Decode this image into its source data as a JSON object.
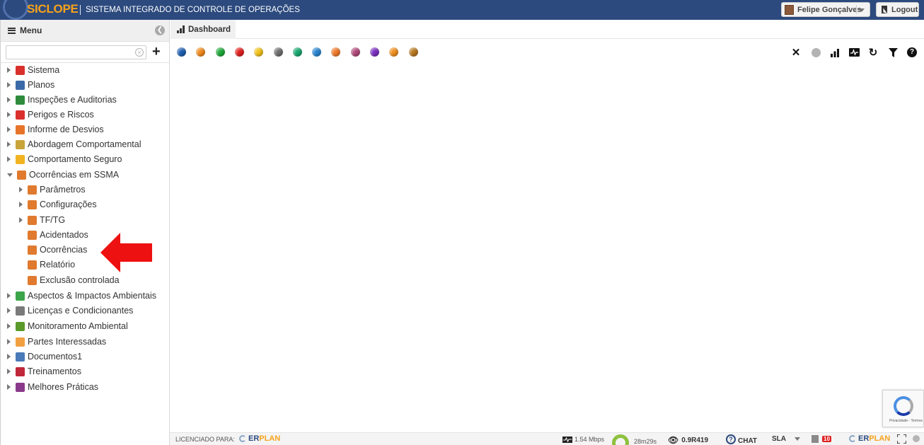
{
  "header": {
    "logo_text": "SICLOPE",
    "system_title": "SISTEMA INTEGRADO DE CONTROLE DE OPERAÇÕES",
    "user_name": "Felipe Gonçalves",
    "logout_label": "Logout"
  },
  "sidebar": {
    "title": "Menu",
    "search": {
      "value": "",
      "placeholder": ""
    },
    "items": [
      {
        "label": "Sistema",
        "icon": "gear-icon",
        "color": "#d9302c"
      },
      {
        "label": "Planos",
        "icon": "plan-icon",
        "color": "#3a6aa8"
      },
      {
        "label": "Inspeções e Auditorias",
        "icon": "clipboard-check-icon",
        "color": "#2e8b3c"
      },
      {
        "label": "Perigos e Riscos",
        "icon": "warning-icon",
        "color": "#d9302c"
      },
      {
        "label": "Informe de Desvios",
        "icon": "megaphone-icon",
        "color": "#e8742a"
      },
      {
        "label": "Abordagem Comportamental",
        "icon": "diamond-icon",
        "color": "#c9a43a"
      },
      {
        "label": "Comportamento Seguro",
        "icon": "hardhat-icon",
        "color": "#f2b321"
      },
      {
        "label": "Ocorrências em SSMA",
        "icon": "folder-open-icon",
        "color": "#e07a2e"
      },
      {
        "label": "Parâmetros",
        "icon": "gear-icon",
        "color": "#e07a2e"
      },
      {
        "label": "Configurações",
        "icon": "sliders-icon",
        "color": "#e07a2e"
      },
      {
        "label": "TF/TG",
        "icon": "bar-chart-icon",
        "color": "#e07a2e"
      },
      {
        "label": "Acidentados",
        "icon": "hospital-icon",
        "color": "#e07a2e"
      },
      {
        "label": "Ocorrências",
        "icon": "person-icon",
        "color": "#e07a2e"
      },
      {
        "label": "Relatório",
        "icon": "excel-icon",
        "color": "#e07a2e"
      },
      {
        "label": "Exclusão controlada",
        "icon": "trash-icon",
        "color": "#e07a2e"
      },
      {
        "label": "Aspectos & Impactos Ambientais",
        "icon": "recycle-icon",
        "color": "#3aa54a"
      },
      {
        "label": "Licenças e Condicionantes",
        "icon": "certificate-icon",
        "color": "#7a7a7a"
      },
      {
        "label": "Monitoramento Ambiental",
        "icon": "tree-icon",
        "color": "#5a9a2a"
      },
      {
        "label": "Partes Interessadas",
        "icon": "people-icon",
        "color": "#f0a040"
      },
      {
        "label": "Documentos1",
        "icon": "document-icon",
        "color": "#4a7ab8"
      },
      {
        "label": "Treinamentos",
        "icon": "trainer-icon",
        "color": "#c0283a"
      },
      {
        "label": "Melhores Práticas",
        "icon": "award-icon",
        "color": "#8a3a8a"
      }
    ]
  },
  "tabs": [
    {
      "label": "Dashboard",
      "icon": "bar-chart-icon"
    }
  ],
  "color_dots": [
    "#1e5fb0",
    "#f08a1c",
    "#1fa83a",
    "#e0201f",
    "#f2c21a",
    "#6f6f6f",
    "#1aa870",
    "#2a86d0",
    "#f07a2a",
    "#b04a7a",
    "#7a30c0",
    "#f09020",
    "#b87820"
  ],
  "toolbar_icons": [
    "close-icon",
    "circle-icon",
    "bar-chart-icon",
    "pulse-icon",
    "refresh-icon",
    "filter-icon",
    "help-icon"
  ],
  "recaptcha": {
    "text": "Privacidade - Termos"
  },
  "statusbar": {
    "licensed_label": "LICENCIADO PARA:",
    "licensee_er": "ER",
    "licensee_plan": "PLAN",
    "speed": "1.54 Mbps",
    "session_time": "28m29s",
    "version": "0.9R419",
    "chat_label": "CHAT",
    "sla_label": "SLA",
    "badge_count": "10"
  }
}
